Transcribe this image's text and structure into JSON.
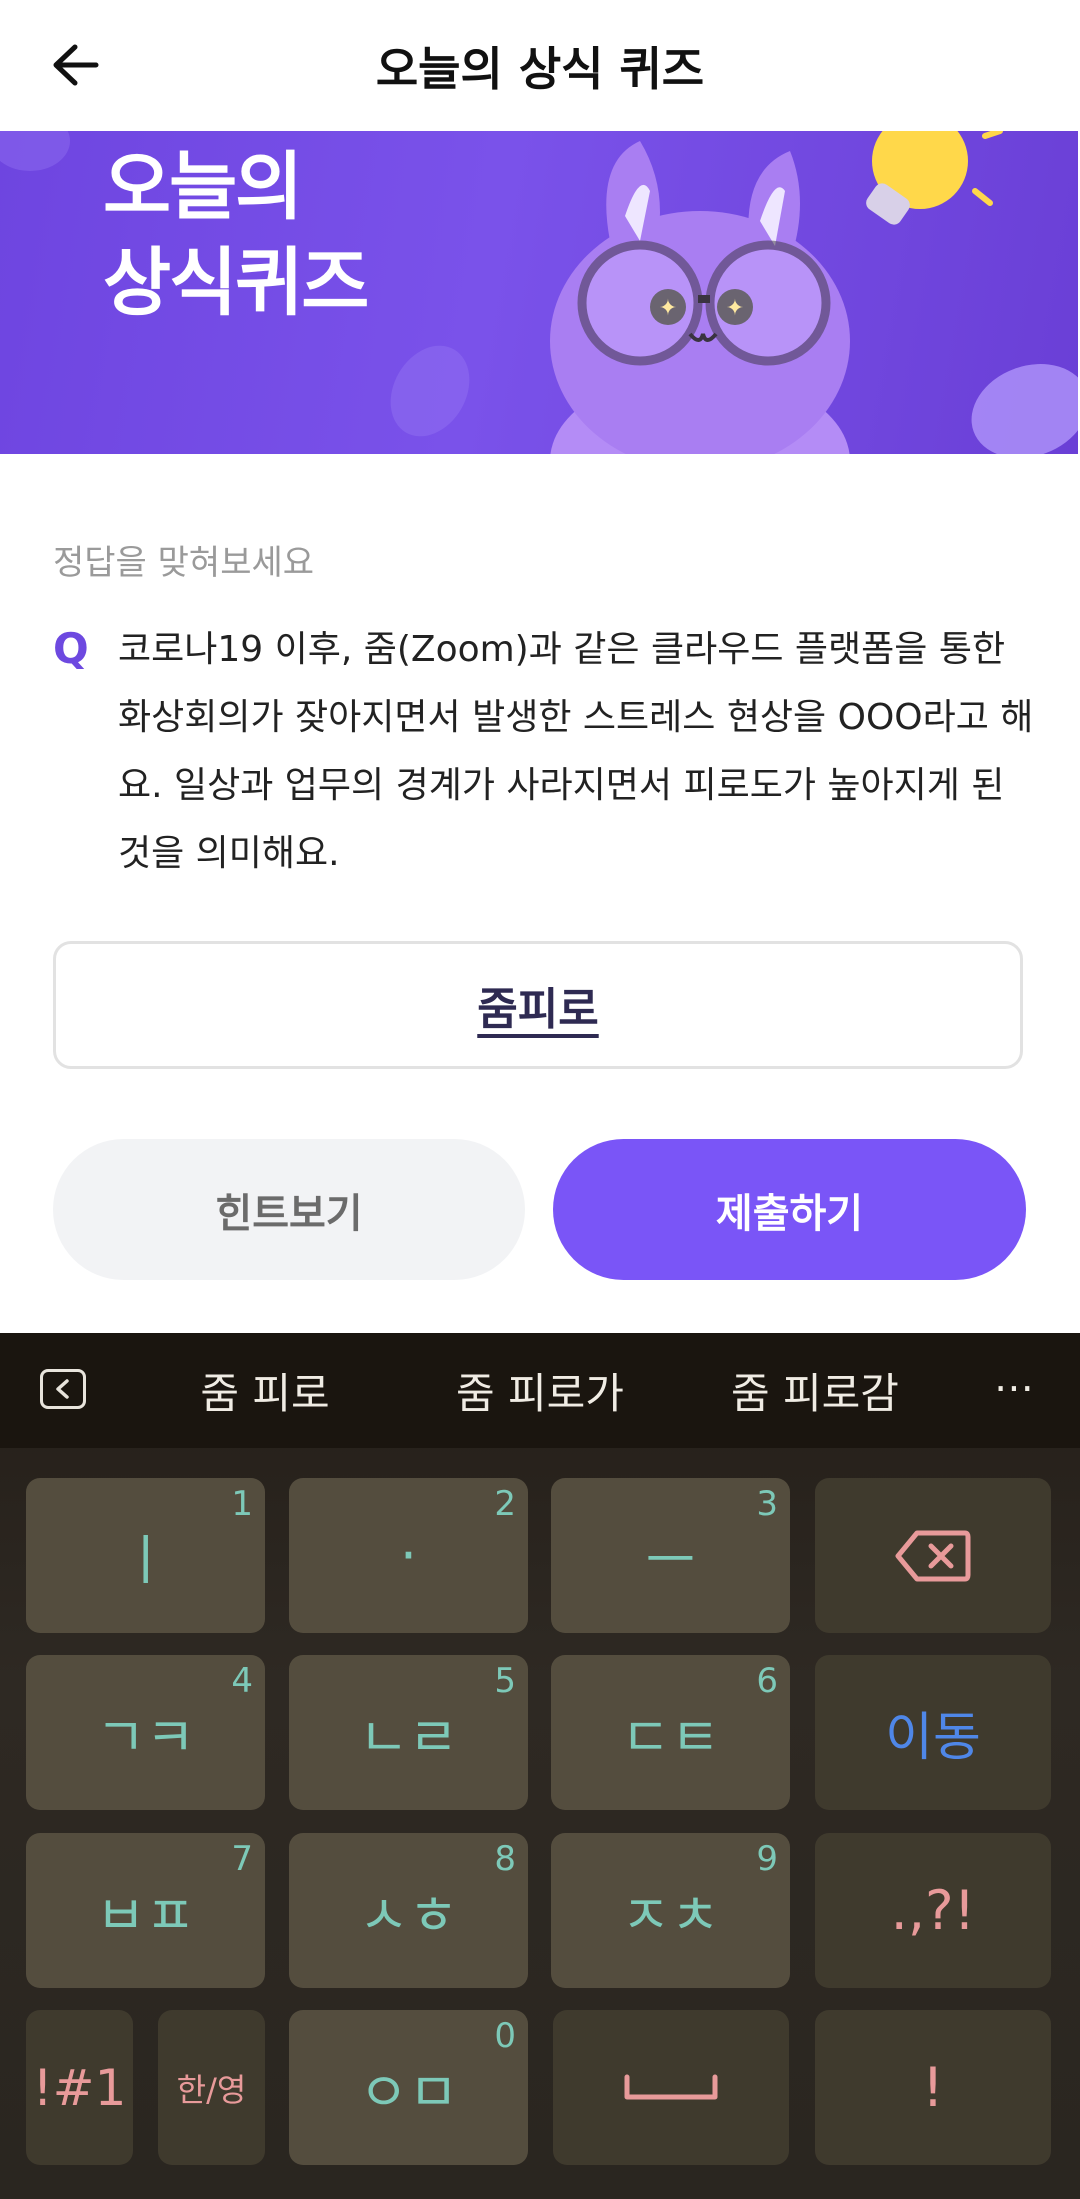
{
  "header": {
    "title": "오늘의 상식 퀴즈"
  },
  "banner": {
    "title_line1": "오늘의",
    "title_line2": "상식퀴즈"
  },
  "quiz": {
    "prompt": "정답을 맞혀보세요",
    "q_mark": "Q",
    "question": "코로나19 이후, 줌(Zoom)과 같은 클라우드 플랫폼을 통한 화상회의가 잦아지면서 발생한 스트레스 현상을 OOO라고 해요. 일상과 업무의 경계가 사라지면서 피로도가 높아지게 된 것을 의미해요.",
    "answer_value": "줌피로",
    "hint_label": "힌트보기",
    "submit_label": "제출하기"
  },
  "keyboard": {
    "suggestions": [
      "줌 피로",
      "줌 피로가",
      "줌 피로감"
    ],
    "more": "⋯",
    "rows": [
      [
        {
          "label": "ㅣ",
          "num": "1"
        },
        {
          "label": "·",
          "num": "2"
        },
        {
          "label": "ㅡ",
          "num": "3"
        },
        {
          "label": "⌫",
          "num": ""
        }
      ],
      [
        {
          "label": "ㄱㅋ",
          "num": "4"
        },
        {
          "label": "ㄴㄹ",
          "num": "5"
        },
        {
          "label": "ㄷㅌ",
          "num": "6"
        },
        {
          "label": "이동",
          "num": ""
        }
      ],
      [
        {
          "label": "ㅂㅍ",
          "num": "7"
        },
        {
          "label": "ㅅㅎ",
          "num": "8"
        },
        {
          "label": "ㅈㅊ",
          "num": "9"
        },
        {
          "label": ".,?!",
          "num": ""
        }
      ],
      [
        {
          "label": "!#1",
          "num": ""
        },
        {
          "label": "한/영",
          "num": ""
        },
        {
          "label": "ㅇㅁ",
          "num": "0"
        },
        {
          "label": "␣",
          "num": ""
        },
        {
          "label": "!",
          "num": ""
        }
      ]
    ],
    "colors": {
      "key_text": "#7dc9b8",
      "blue": "#4f87e8",
      "pink": "#e89a9a"
    }
  },
  "colors": {
    "accent": "#7a55f7",
    "banner": "#6e45e0"
  }
}
